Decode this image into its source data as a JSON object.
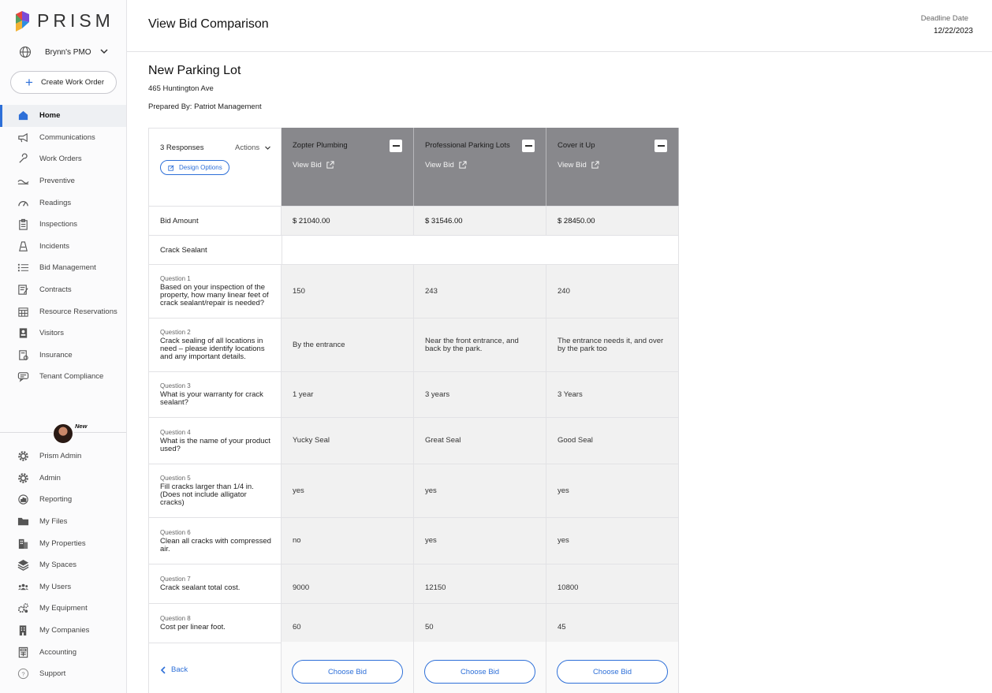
{
  "app": {
    "logo_text": "PRISM",
    "org_name": "Brynn's PMO",
    "create_label": "Create Work Order",
    "accent": "#2d6fd8"
  },
  "sidebar": {
    "items": [
      {
        "label": "Home",
        "icon": "home-icon",
        "active": true
      },
      {
        "label": "Communications",
        "icon": "megaphone-icon"
      },
      {
        "label": "Work Orders",
        "icon": "wrench-icon"
      },
      {
        "label": "Preventive",
        "icon": "preventive-icon"
      },
      {
        "label": "Readings",
        "icon": "gauge-icon"
      },
      {
        "label": "Inspections",
        "icon": "clipboard-icon"
      },
      {
        "label": "Incidents",
        "icon": "cone-icon"
      },
      {
        "label": "Bid Management",
        "icon": "list-icon"
      },
      {
        "label": "Contracts",
        "icon": "contract-icon"
      },
      {
        "label": "Resource Reservations",
        "icon": "calendar-icon"
      },
      {
        "label": "Visitors",
        "icon": "badge-icon"
      },
      {
        "label": "Insurance",
        "icon": "insurance-icon"
      },
      {
        "label": "Tenant Compliance",
        "icon": "compliance-icon"
      }
    ],
    "new_tag": "New",
    "admin_items": [
      {
        "label": "Prism Admin",
        "icon": "gear-icon"
      },
      {
        "label": "Admin",
        "icon": "gear-icon"
      },
      {
        "label": "Reporting",
        "icon": "reporting-icon"
      },
      {
        "label": "My Files",
        "icon": "folder-icon"
      },
      {
        "label": "My Properties",
        "icon": "building-icon"
      },
      {
        "label": "My Spaces",
        "icon": "layers-icon"
      },
      {
        "label": "My Users",
        "icon": "users-icon"
      },
      {
        "label": "My Equipment",
        "icon": "equipment-icon"
      },
      {
        "label": "My Companies",
        "icon": "company-icon"
      },
      {
        "label": "Accounting",
        "icon": "calculator-icon"
      },
      {
        "label": "Support",
        "icon": "help-icon"
      }
    ]
  },
  "header": {
    "title": "View Bid Comparison",
    "deadline_label": "Deadline Date",
    "deadline_value": "12/22/2023"
  },
  "project": {
    "name": "New Parking Lot",
    "address": "465 Huntington Ave",
    "prepared_by": "Prepared By: Patriot Management"
  },
  "table": {
    "responses": "3 Responses",
    "actions": "Actions",
    "design_options": "Design Options",
    "view_bid": "View Bid",
    "vendors": [
      "Zopter Plumbing",
      "Professional Parking Lots",
      "Cover it Up"
    ],
    "bid_amount_label": "Bid Amount",
    "bid_amounts": [
      "$ 21040.00",
      "$ 31546.00",
      "$ 28450.00"
    ],
    "section": "Crack Sealant",
    "questions": [
      {
        "num": "Question 1",
        "text": "Based on your inspection of the property, how many linear feet of crack sealant/repair is needed?",
        "answers": [
          "150",
          "243",
          "240"
        ]
      },
      {
        "num": "Question 2",
        "text": "Crack sealing of all locations in need – please identify locations and any important details.",
        "answers": [
          "By the entrance",
          "Near the front entrance, and back by the park.",
          "The entrance needs it, and over by the park too"
        ]
      },
      {
        "num": "Question 3",
        "text": "What is your warranty for crack sealant?",
        "answers": [
          "1 year",
          "3 years",
          "3 Years"
        ]
      },
      {
        "num": "Question 4",
        "text": "What is the name of your product used?",
        "answers": [
          "Yucky Seal",
          "Great Seal",
          "Good Seal"
        ]
      },
      {
        "num": "Question 5",
        "text": "Fill cracks larger than 1/4 in. (Does not include alligator cracks)",
        "answers": [
          "yes",
          "yes",
          "yes"
        ]
      },
      {
        "num": "Question 6",
        "text": "Clean all cracks with compressed air.",
        "answers": [
          "no",
          "yes",
          "yes"
        ]
      },
      {
        "num": "Question 7",
        "text": "Crack sealant total cost.",
        "answers": [
          "9000",
          "12150",
          "10800"
        ]
      },
      {
        "num": "Question 8",
        "text": "Cost per linear foot.",
        "answers": [
          "60",
          "50",
          "45"
        ]
      }
    ],
    "back_label": "Back",
    "choose_label": "Choose Bid"
  }
}
